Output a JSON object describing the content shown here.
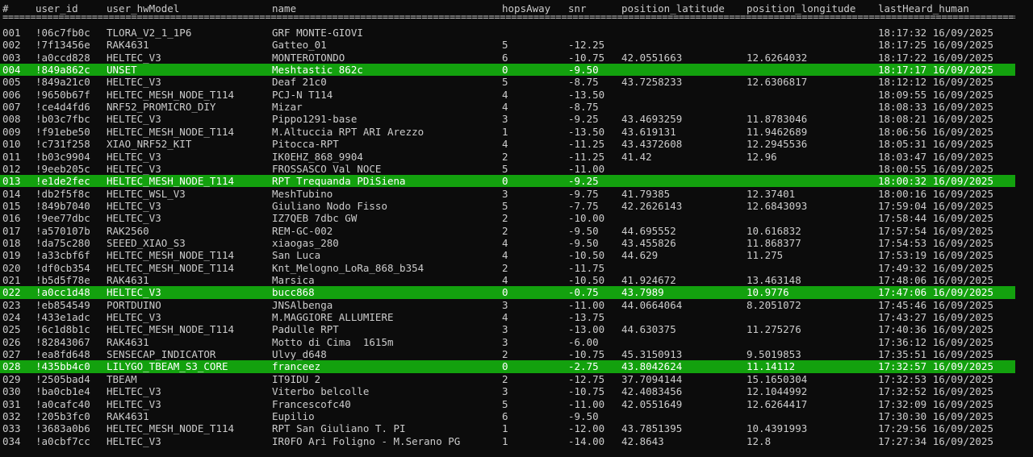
{
  "columns": [
    "#",
    "user_id",
    "user_hwModel",
    "name",
    "hopsAway",
    "snr",
    "position_latitude",
    "position_longitude",
    "lastHeard_human"
  ],
  "separator": "==========================================================================================================================================================================================================",
  "highlight_color": "#13a10e",
  "rows": [
    {
      "num": "001",
      "id": "!06c7fb0c",
      "hw": "TLORA_V2_1_1P6",
      "name": "GRF MONTE-GIOVI",
      "hops": "",
      "snr": "",
      "lat": "",
      "lon": "",
      "last": "18:17:32 16/09/2025",
      "hl": false
    },
    {
      "num": "002",
      "id": "!7f13456e",
      "hw": "RAK4631",
      "name": "Gatteo_01",
      "hops": "5",
      "snr": "-12.25",
      "lat": "",
      "lon": "",
      "last": "18:17:25 16/09/2025",
      "hl": false
    },
    {
      "num": "003",
      "id": "!a0ccd828",
      "hw": "HELTEC_V3",
      "name": "MONTEROTONDO",
      "hops": "6",
      "snr": "-10.75",
      "lat": "42.0551663",
      "lon": "12.6264032",
      "last": "18:17:22 16/09/2025",
      "hl": false
    },
    {
      "num": "004",
      "id": "!849a862c",
      "hw": "UNSET",
      "name": "Meshtastic 862c",
      "hops": "0",
      "snr": "-9.50",
      "lat": "",
      "lon": "",
      "last": "18:17:17 16/09/2025",
      "hl": true
    },
    {
      "num": "005",
      "id": "!849a21c0",
      "hw": "HELTEC_V3",
      "name": "Deaf 21c0",
      "hops": "5",
      "snr": "-8.75",
      "lat": "43.7258233",
      "lon": "12.6306817",
      "last": "18:12:12 16/09/2025",
      "hl": false
    },
    {
      "num": "006",
      "id": "!9650b67f",
      "hw": "HELTEC_MESH_NODE_T114",
      "name": "PCJ-N T114",
      "hops": "4",
      "snr": "-13.50",
      "lat": "",
      "lon": "",
      "last": "18:09:55 16/09/2025",
      "hl": false
    },
    {
      "num": "007",
      "id": "!ce4d4fd6",
      "hw": "NRF52_PROMICRO_DIY",
      "name": "Mizar",
      "hops": "4",
      "snr": "-8.75",
      "lat": "",
      "lon": "",
      "last": "18:08:33 16/09/2025",
      "hl": false
    },
    {
      "num": "008",
      "id": "!b03c7fbc",
      "hw": "HELTEC_V3",
      "name": "Pippo1291-base",
      "hops": "3",
      "snr": "-9.25",
      "lat": "43.4693259",
      "lon": "11.8783046",
      "last": "18:08:21 16/09/2025",
      "hl": false
    },
    {
      "num": "009",
      "id": "!f91ebe50",
      "hw": "HELTEC_MESH_NODE_T114",
      "name": "M.Altuccia RPT ARI Arezzo",
      "hops": "1",
      "snr": "-13.50",
      "lat": "43.619131",
      "lon": "11.9462689",
      "last": "18:06:56 16/09/2025",
      "hl": false
    },
    {
      "num": "010",
      "id": "!c731f258",
      "hw": "XIAO_NRF52_KIT",
      "name": "Pitocca-RPT",
      "hops": "4",
      "snr": "-11.25",
      "lat": "43.4372608",
      "lon": "12.2945536",
      "last": "18:05:31 16/09/2025",
      "hl": false
    },
    {
      "num": "011",
      "id": "!b03c9904",
      "hw": "HELTEC_V3",
      "name": "IK0EHZ_868_9904",
      "hops": "2",
      "snr": "-11.25",
      "lat": "41.42",
      "lon": "12.96",
      "last": "18:03:47 16/09/2025",
      "hl": false
    },
    {
      "num": "012",
      "id": "!9eeb205c",
      "hw": "HELTEC_V3",
      "name": "FROSSASCO Val NOCE",
      "hops": "5",
      "snr": "-11.00",
      "lat": "",
      "lon": "",
      "last": "18:00:55 16/09/2025",
      "hl": false
    },
    {
      "num": "013",
      "id": "!e1de2fec",
      "hw": "HELTEC_MESH_NODE_T114",
      "name": "RPT Trequanda PDiSiena",
      "hops": "0",
      "snr": "-9.25",
      "lat": "",
      "lon": "",
      "last": "18:00:32 16/09/2025",
      "hl": true
    },
    {
      "num": "014",
      "id": "!db2f5f8c",
      "hw": "HELTEC_WSL_V3",
      "name": "MeshTubino",
      "hops": "3",
      "snr": "-9.75",
      "lat": "41.79385",
      "lon": "12.37401",
      "last": "18:00:16 16/09/2025",
      "hl": false
    },
    {
      "num": "015",
      "id": "!849b7040",
      "hw": "HELTEC_V3",
      "name": "Giuliano Nodo Fisso",
      "hops": "5",
      "snr": "-7.75",
      "lat": "42.2626143",
      "lon": "12.6843093",
      "last": "17:59:04 16/09/2025",
      "hl": false
    },
    {
      "num": "016",
      "id": "!9ee77dbc",
      "hw": "HELTEC_V3",
      "name": "IZ7QEB 7dbc GW",
      "hops": "2",
      "snr": "-10.00",
      "lat": "",
      "lon": "",
      "last": "17:58:44 16/09/2025",
      "hl": false
    },
    {
      "num": "017",
      "id": "!a570107b",
      "hw": "RAK2560",
      "name": "REM-GC-002",
      "hops": "2",
      "snr": "-9.50",
      "lat": "44.695552",
      "lon": "10.616832",
      "last": "17:57:54 16/09/2025",
      "hl": false
    },
    {
      "num": "018",
      "id": "!da75c280",
      "hw": "SEEED_XIAO_S3",
      "name": "xiaogas_280",
      "hops": "4",
      "snr": "-9.50",
      "lat": "43.455826",
      "lon": "11.868377",
      "last": "17:54:53 16/09/2025",
      "hl": false
    },
    {
      "num": "019",
      "id": "!a33cbf6f",
      "hw": "HELTEC_MESH_NODE_T114",
      "name": "San Luca",
      "hops": "4",
      "snr": "-10.50",
      "lat": "44.629",
      "lon": "11.275",
      "last": "17:53:19 16/09/2025",
      "hl": false
    },
    {
      "num": "020",
      "id": "!df0cb354",
      "hw": "HELTEC_MESH_NODE_T114",
      "name": "Knt_Melogno_LoRa_868_b354",
      "hops": "2",
      "snr": "-11.75",
      "lat": "",
      "lon": "",
      "last": "17:49:32 16/09/2025",
      "hl": false
    },
    {
      "num": "021",
      "id": "!b5d5f78e",
      "hw": "RAK4631",
      "name": "Marsica",
      "hops": "4",
      "snr": "-10.50",
      "lat": "41.924672",
      "lon": "13.463148",
      "last": "17:48:06 16/09/2025",
      "hl": false
    },
    {
      "num": "022",
      "id": "!a0cc1d48",
      "hw": "HELTEC_V3",
      "name": "bucc868",
      "hops": "0",
      "snr": "-0.75",
      "lat": "43.7989",
      "lon": "10.9776",
      "last": "17:47:06 16/09/2025",
      "hl": true
    },
    {
      "num": "023",
      "id": "!eb854549",
      "hw": "PORTDUINO",
      "name": "JNSAlbenga",
      "hops": "3",
      "snr": "-11.00",
      "lat": "44.0664064",
      "lon": "8.2051072",
      "last": "17:45:46 16/09/2025",
      "hl": false
    },
    {
      "num": "024",
      "id": "!433e1adc",
      "hw": "HELTEC_V3",
      "name": "M.MAGGIORE ALLUMIERE",
      "hops": "4",
      "snr": "-13.75",
      "lat": "",
      "lon": "",
      "last": "17:43:27 16/09/2025",
      "hl": false
    },
    {
      "num": "025",
      "id": "!6c1d8b1c",
      "hw": "HELTEC_MESH_NODE_T114",
      "name": "Padulle RPT",
      "hops": "3",
      "snr": "-13.00",
      "lat": "44.630375",
      "lon": "11.275276",
      "last": "17:40:36 16/09/2025",
      "hl": false
    },
    {
      "num": "026",
      "id": "!82843067",
      "hw": "RAK4631",
      "name": "Motto di Cima  1615m",
      "hops": "3",
      "snr": "-6.00",
      "lat": "",
      "lon": "",
      "last": "17:36:12 16/09/2025",
      "hl": false
    },
    {
      "num": "027",
      "id": "!ea8fd648",
      "hw": "SENSECAP_INDICATOR",
      "name": "Ulvy_d648",
      "hops": "2",
      "snr": "-10.75",
      "lat": "45.3150913",
      "lon": "9.5019853",
      "last": "17:35:51 16/09/2025",
      "hl": false
    },
    {
      "num": "028",
      "id": "!435bb4c0",
      "hw": "LILYGO_TBEAM_S3_CORE",
      "name": "franceez",
      "hops": "0",
      "snr": "-2.75",
      "lat": "43.8042624",
      "lon": "11.14112",
      "last": "17:32:57 16/09/2025",
      "hl": true
    },
    {
      "num": "029",
      "id": "!2505bad4",
      "hw": "TBEAM",
      "name": "IT9IDU 2",
      "hops": "2",
      "snr": "-12.75",
      "lat": "37.7094144",
      "lon": "15.1650304",
      "last": "17:32:53 16/09/2025",
      "hl": false
    },
    {
      "num": "030",
      "id": "!ba0cb1e4",
      "hw": "HELTEC_V3",
      "name": "Viterbo belcolle",
      "hops": "3",
      "snr": "-10.75",
      "lat": "42.4083456",
      "lon": "12.1044992",
      "last": "17:32:52 16/09/2025",
      "hl": false
    },
    {
      "num": "031",
      "id": "!a0cafc40",
      "hw": "HELTEC_V3",
      "name": "Francescofc40",
      "hops": "5",
      "snr": "-11.00",
      "lat": "42.0551649",
      "lon": "12.6264417",
      "last": "17:32:09 16/09/2025",
      "hl": false
    },
    {
      "num": "032",
      "id": "!205b3fc0",
      "hw": "RAK4631",
      "name": "Eupilio",
      "hops": "6",
      "snr": "-9.50",
      "lat": "",
      "lon": "",
      "last": "17:30:30 16/09/2025",
      "hl": false
    },
    {
      "num": "033",
      "id": "!3683a0b6",
      "hw": "HELTEC_MESH_NODE_T114",
      "name": "RPT San Giuliano T. PI",
      "hops": "1",
      "snr": "-12.00",
      "lat": "43.7851395",
      "lon": "10.4391993",
      "last": "17:29:56 16/09/2025",
      "hl": false
    },
    {
      "num": "034",
      "id": "!a0cbf7cc",
      "hw": "HELTEC_V3",
      "name": "IR0FO Ari Foligno - M.Serano PG",
      "hops": "1",
      "snr": "-14.00",
      "lat": "42.8643",
      "lon": "12.8",
      "last": "17:27:34 16/09/2025",
      "hl": false
    }
  ]
}
